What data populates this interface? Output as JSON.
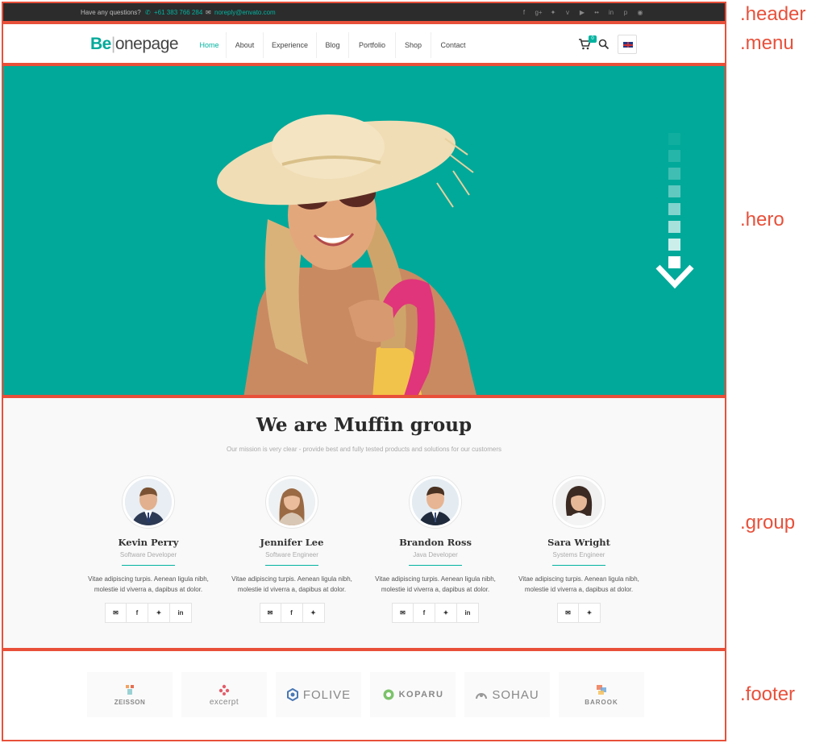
{
  "labels": {
    "header": ".header",
    "menu": ".menu",
    "hero": ".hero",
    "group": ".group",
    "footer": ".footer"
  },
  "header": {
    "question": "Have any questions?",
    "phone": "+61 383 766 284",
    "email": "noreply@envato.com",
    "social_icons": [
      "facebook-icon",
      "google-plus-icon",
      "twitter-icon",
      "vimeo-icon",
      "youtube-icon",
      "flickr-icon",
      "linkedin-icon",
      "pinterest-icon",
      "dribbble-icon"
    ]
  },
  "menu": {
    "logo_be": "Be",
    "logo_rest": "onepage",
    "items": [
      "Home",
      "About",
      "Experience",
      "Blog",
      "Portfolio",
      "Shop",
      "Contact"
    ],
    "active_item": "Home",
    "cart_count": "0"
  },
  "hero": {
    "image": "woman-in-sun-hat-photo",
    "scroll_icon": "scroll-down-arrow-icon"
  },
  "group": {
    "title": "We are Muffin group",
    "subtitle": "Our mission is very clear - provide best and fully tested products and solutions for our customers",
    "members": [
      {
        "name": "Kevin Perry",
        "role": "Software Developer",
        "desc_1": "Vitae adipiscing turpis. Aenean ligula nibh,",
        "desc_2": "molestie id viverra a, dapibus at dolor."
      },
      {
        "name": "Jennifer Lee",
        "role": "Software Engineer",
        "desc_1": "Vitae adipiscing turpis. Aenean ligula nibh,",
        "desc_2": "molestie id viverra a, dapibus at dolor."
      },
      {
        "name": "Brandon Ross",
        "role": "Java Developer",
        "desc_1": "Vitae adipiscing turpis. Aenean ligula nibh,",
        "desc_2": "molestie id viverra a, dapibus at dolor."
      },
      {
        "name": "Sara Wright",
        "role": "Systems Engineer",
        "desc_1": "Vitae adipiscing turpis. Aenean ligula nibh,",
        "desc_2": "molestie id viverra a, dapibus at dolor."
      }
    ]
  },
  "footer": {
    "clients": [
      "ZEISSON",
      "excerpt",
      "FOLIVE",
      "KOPARU",
      "SOHAU",
      "BAROOK"
    ]
  },
  "colors": {
    "accent": "#00b3a0",
    "hero_bg": "#00a99a",
    "annotation": "#e8503a",
    "header_bg": "#2c2c2c"
  }
}
